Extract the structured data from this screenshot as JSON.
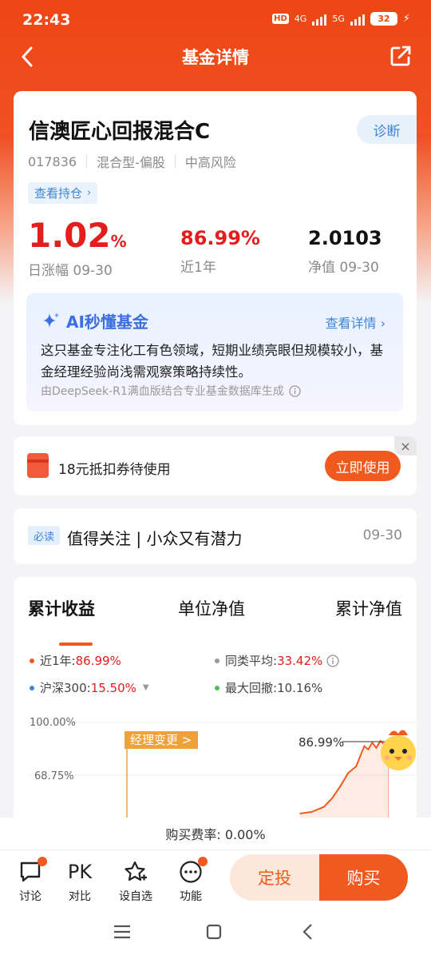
{
  "status_bar": {
    "time": "22:43",
    "hd": "HD",
    "net1": "4G",
    "net2": "5G",
    "battery": "32"
  },
  "header": {
    "title": "基金详情"
  },
  "fund": {
    "name": "信澳匠心回报混合C",
    "diagnose_label": "诊断",
    "code": "017836",
    "category": "混合型-偏股",
    "risk": "中高风险",
    "holding_label": "查看持仓",
    "daily_change": "1.02",
    "daily_change_unit": "%",
    "daily_label": "日涨幅 09-30",
    "year_return": "86.99%",
    "year_label": "近1年",
    "nav": "2.0103",
    "nav_label": "净值 09-30"
  },
  "ai": {
    "title": "AI秒懂基金",
    "more": "查看详情",
    "text": "这只基金专注化工有色领域，短期业绩亮眼但规模较小，基金经理经验尚浅需观察策略持续性。",
    "footer": "由DeepSeek-R1满血版结合专业基金数据库生成"
  },
  "coupon": {
    "text": "18元抵扣券待使用",
    "button": "立即使用",
    "close": "×"
  },
  "news": {
    "tag": "必读",
    "title": "值得关注 | 小众又有潜力",
    "date": "09-30"
  },
  "performance": {
    "tabs": [
      "累计收益",
      "单位净值",
      "累计净值"
    ],
    "legend": [
      {
        "label": "近1年:",
        "value": "86.99%",
        "color": "#f05a1e"
      },
      {
        "label": "同类平均:",
        "value": "33.42%",
        "color": "#999999"
      },
      {
        "label": "沪深300:",
        "value": "15.50%",
        "color": "#3f85d8"
      },
      {
        "label": "最大回撤:",
        "value": "10.16%",
        "color": "#4cbf5a"
      }
    ]
  },
  "chart_data": {
    "type": "line",
    "y_ticks": [
      "100.00%",
      "68.75%"
    ],
    "annotation": "经理变更 >",
    "end_label": "86.99%",
    "series": [
      {
        "name": "近1年",
        "color": "#f05a1e",
        "points": [
          [
            0.71,
            46
          ],
          [
            0.74,
            47
          ],
          [
            0.77,
            50
          ],
          [
            0.79,
            55
          ],
          [
            0.81,
            62
          ],
          [
            0.83,
            70
          ],
          [
            0.85,
            74
          ],
          [
            0.86,
            80
          ],
          [
            0.87,
            86
          ],
          [
            0.88,
            84
          ],
          [
            0.89,
            88
          ],
          [
            0.9,
            85
          ],
          [
            0.91,
            89
          ],
          [
            0.92,
            87
          ],
          [
            0.93,
            86.99
          ]
        ]
      }
    ]
  },
  "bottom": {
    "fee": "购买费率: 0.00%",
    "actions": [
      "讨论",
      "对比",
      "设自选",
      "功能"
    ],
    "pk": "PK",
    "dingtou": "定投",
    "buy": "购买"
  },
  "colors": {
    "brand": "#ee4615",
    "accent": "#f05a1e",
    "up": "#e41d1d",
    "link": "#3f85d8"
  }
}
